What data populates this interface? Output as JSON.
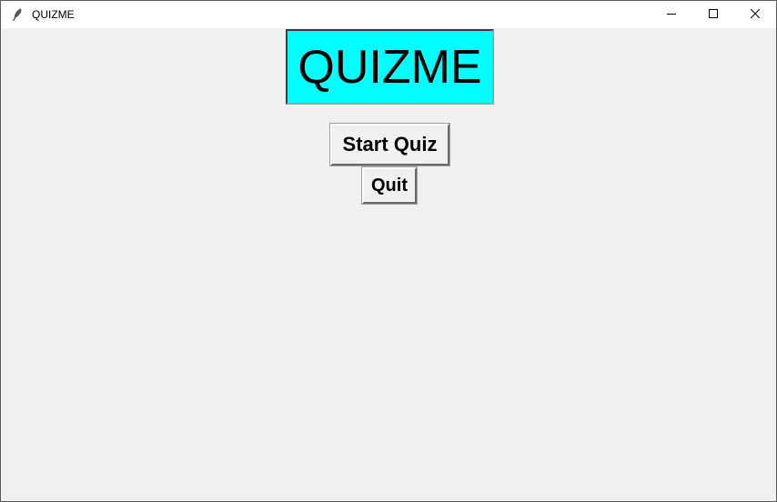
{
  "window": {
    "title": "QUIZME",
    "icon": "feather-icon",
    "controls": {
      "minimize": "minimize-icon",
      "maximize": "maximize-icon",
      "close": "close-icon"
    }
  },
  "main": {
    "heading": "QUIZME",
    "heading_bg": "#00ffff",
    "start_label": "Start Quiz",
    "quit_label": "Quit"
  }
}
